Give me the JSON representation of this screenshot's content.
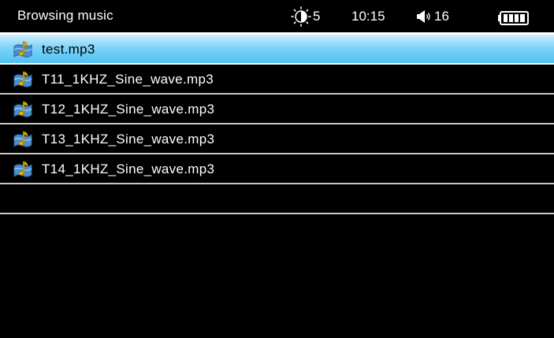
{
  "window": {
    "title": "Browsing music"
  },
  "status": {
    "brightness_value": "5",
    "time": "10:15",
    "volume_value": "16",
    "battery_icon": "battery-full-icon"
  },
  "files": [
    {
      "name": "test.mp3",
      "selected": true,
      "icon": "music-file-icon"
    },
    {
      "name": "T11_1KHZ_Sine_wave.mp3",
      "selected": false,
      "icon": "music-file-icon"
    },
    {
      "name": "T12_1KHZ_Sine_wave.mp3",
      "selected": false,
      "icon": "music-file-icon"
    },
    {
      "name": "T13_1KHZ_Sine_wave.mp3",
      "selected": false,
      "icon": "music-file-icon"
    },
    {
      "name": "T14_1KHZ_Sine_wave.mp3",
      "selected": false,
      "icon": "music-file-icon"
    }
  ],
  "colors": {
    "background": "#000000",
    "highlight": "#4fc1f3",
    "text": "#ffffff",
    "selected_text": "#000000"
  }
}
